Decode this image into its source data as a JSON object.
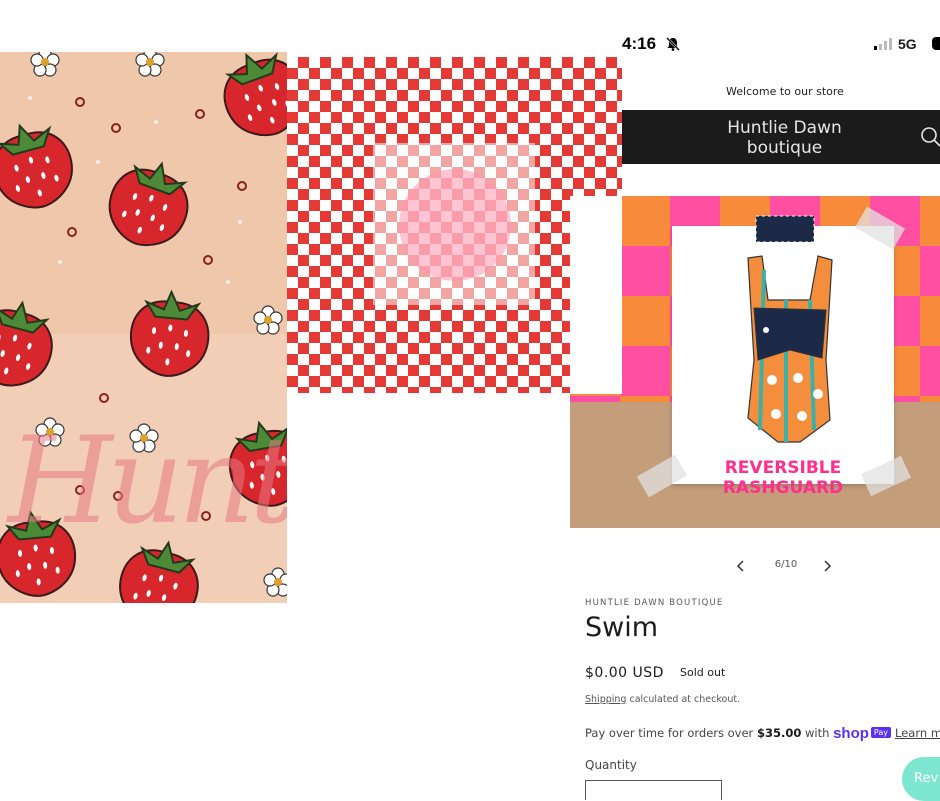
{
  "collage": {
    "strawberry_watermark": "Huntl"
  },
  "status_bar": {
    "time": "4:16",
    "network": "5G"
  },
  "store": {
    "announcement": "Welcome to our store",
    "name_line1": "Huntlie Dawn",
    "name_line2": "boutique"
  },
  "product_image": {
    "caption": "REVERSIBLE RASHGUARD"
  },
  "gallery": {
    "counter": "6/10"
  },
  "product": {
    "vendor": "HUNTLIE DAWN BOUTIQUE",
    "title": "Swim",
    "price": "$0.00 USD",
    "badge": "Sold out",
    "shipping_link": "Shipping",
    "shipping_text": " calculated at checkout.",
    "installments_prefix": "Pay over time for orders over ",
    "installments_amount": "$35.00",
    "installments_with": " with ",
    "shop_brand": "shop",
    "shop_pay_badge": "Pay",
    "learn_more": "Learn more",
    "quantity_label": "Quantity"
  },
  "review_widget": {
    "label": "Rev"
  },
  "colors": {
    "strawberry_bg": "#efc7ab",
    "checker_red": "#e53935",
    "header_dark": "#1b1b1b",
    "shop_pay_purple": "#5a31f4",
    "rashguard_pink": "#ff2f8e",
    "review_teal": "#7de6d0"
  }
}
